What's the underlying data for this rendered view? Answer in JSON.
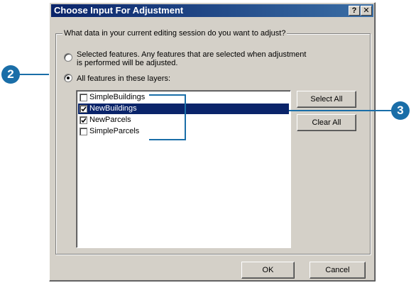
{
  "dialog": {
    "title": "Choose Input For Adjustment",
    "help_button": "?",
    "close_button": "✕"
  },
  "group": {
    "legend": "What data in your current editing session do you want to adjust?"
  },
  "options": {
    "selected_features": {
      "line1": "Selected features.  Any features that are selected when adjustment",
      "line2": "is performed will be adjusted.",
      "checked": false
    },
    "all_features": {
      "label": "All features in these layers:",
      "checked": true
    }
  },
  "layers": [
    {
      "label": "SimpleBuildings",
      "checked": false,
      "selected": false
    },
    {
      "label": "NewBuildings",
      "checked": true,
      "selected": true
    },
    {
      "label": "NewParcels",
      "checked": true,
      "selected": false
    },
    {
      "label": "SimpleParcels",
      "checked": false,
      "selected": false
    }
  ],
  "buttons": {
    "select_all": "Select All",
    "clear_all": "Clear All",
    "ok": "OK",
    "cancel": "Cancel"
  },
  "callouts": {
    "step2": "2",
    "step3": "3",
    "color": "#1a6ea8"
  }
}
